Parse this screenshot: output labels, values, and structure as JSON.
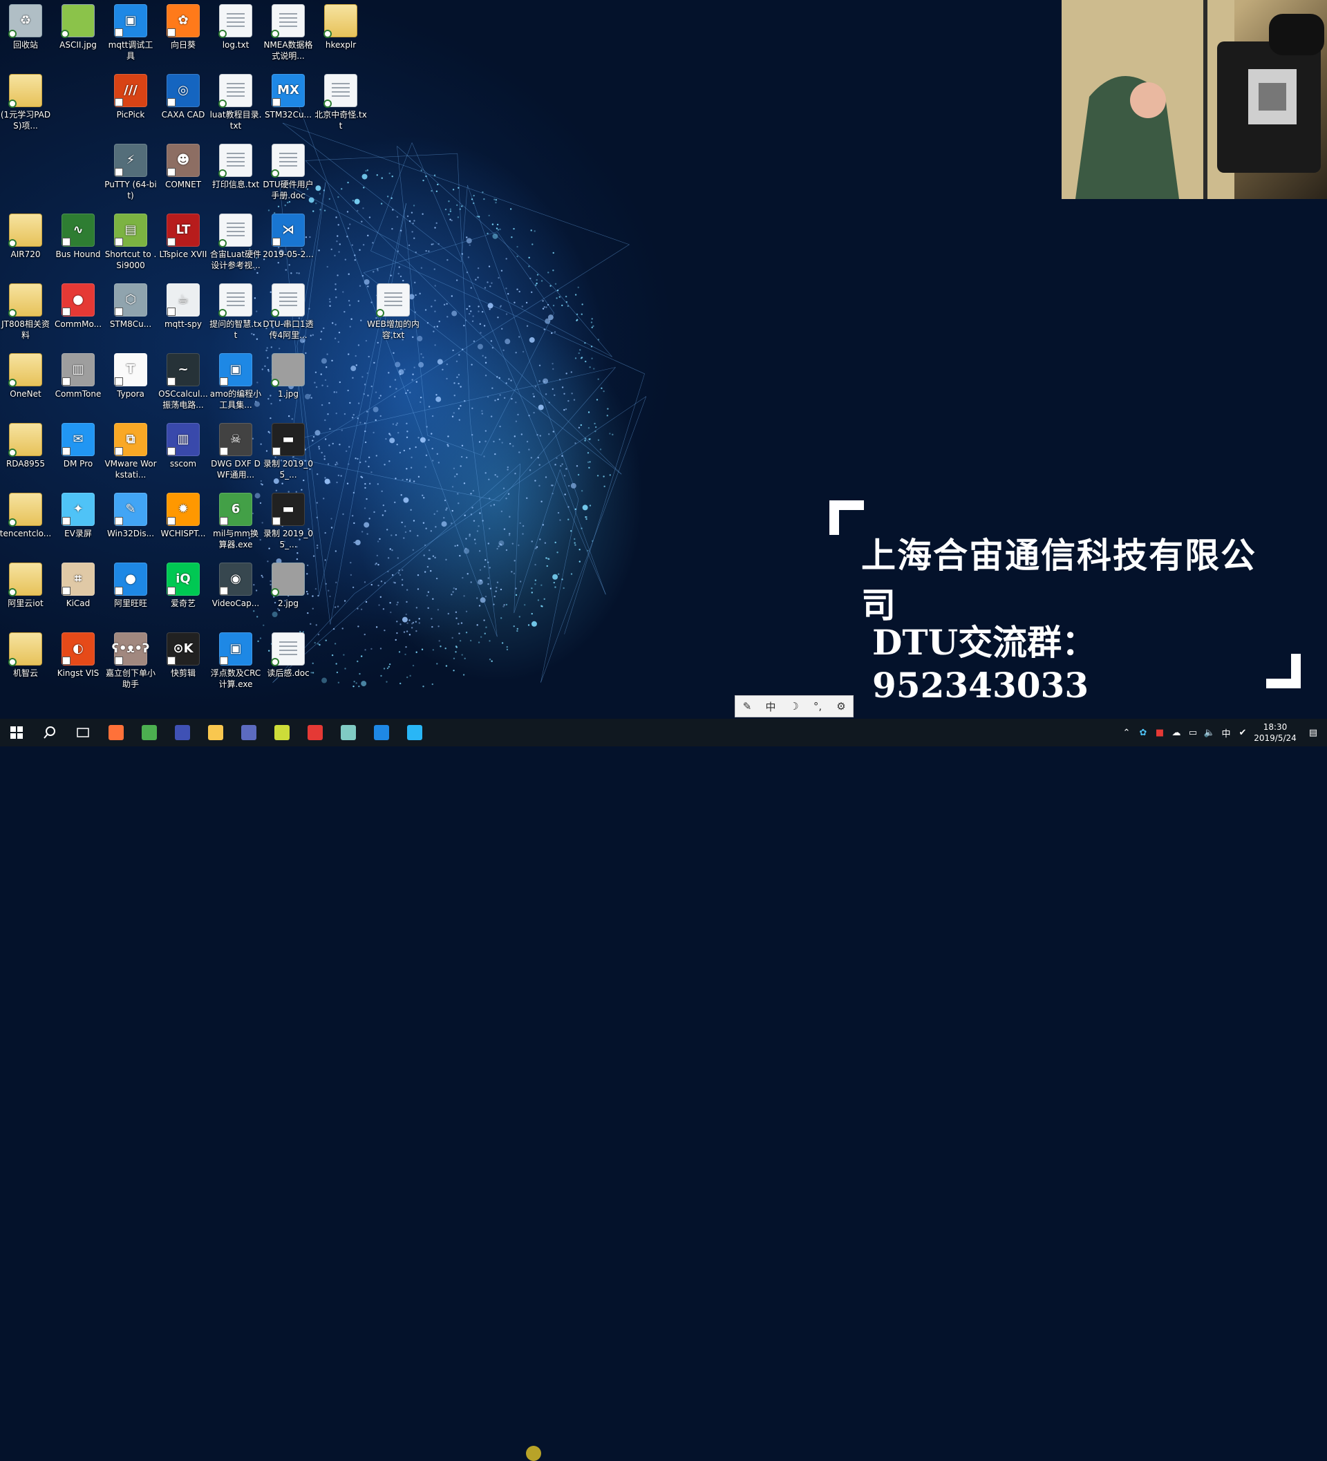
{
  "desktop_icons": [
    {
      "label": "回收站",
      "kind": "img",
      "color": "#b0bec5",
      "glyph": "♻"
    },
    {
      "label": "ASCII.jpg",
      "kind": "img",
      "color": "#8bc34a",
      "glyph": ""
    },
    {
      "label": "mqtt调试工具",
      "kind": "app",
      "color": "#1e88e5",
      "glyph": "▣"
    },
    {
      "label": "向日葵",
      "kind": "app",
      "color": "#ff7a1a",
      "glyph": "✿"
    },
    {
      "label": "log.txt",
      "kind": "doc",
      "color": "",
      "glyph": ""
    },
    {
      "label": "NMEA数据格式说明...",
      "kind": "doc",
      "color": "",
      "glyph": ""
    },
    {
      "label": "hkexplr",
      "kind": "folder",
      "color": "",
      "glyph": ""
    },
    {
      "label": "(1元学习PADS)项...",
      "kind": "folder",
      "color": "",
      "glyph": ""
    },
    {
      "label": "PicPick",
      "kind": "app",
      "color": "#d84315",
      "glyph": "///"
    },
    {
      "label": "CAXA CAD",
      "kind": "app",
      "color": "#1565c0",
      "glyph": "◎"
    },
    {
      "label": "luat教程目录.txt",
      "kind": "doc",
      "color": "",
      "glyph": ""
    },
    {
      "label": "STM32Cu...",
      "kind": "app",
      "color": "#1e88e5",
      "glyph": "MX"
    },
    {
      "label": "北京中奇怪.txt",
      "kind": "doc",
      "color": "",
      "glyph": ""
    },
    {
      "label": "PuTTY (64-bit)",
      "kind": "app",
      "color": "#546e7a",
      "glyph": "⚡"
    },
    {
      "label": "COMNET",
      "kind": "app",
      "color": "#8d6e63",
      "glyph": "☻"
    },
    {
      "label": "打印信息.txt",
      "kind": "doc",
      "color": "",
      "glyph": ""
    },
    {
      "label": "DTU硬件用户手册.doc",
      "kind": "doc",
      "color": "",
      "glyph": ""
    },
    {
      "label": "AIR720",
      "kind": "folder",
      "color": "",
      "glyph": ""
    },
    {
      "label": "Bus Hound",
      "kind": "app",
      "color": "#2e7d32",
      "glyph": "∿"
    },
    {
      "label": "Shortcut to .Si9000",
      "kind": "app",
      "color": "#7cb342",
      "glyph": "▤"
    },
    {
      "label": "LTspice XVII",
      "kind": "app",
      "color": "#b71c1c",
      "glyph": "LT"
    },
    {
      "label": "合宙Luat硬件设计参考视...",
      "kind": "doc",
      "color": "",
      "glyph": ""
    },
    {
      "label": "2019-05-2...",
      "kind": "app",
      "color": "#1976d2",
      "glyph": "⋊"
    },
    {
      "label": "JT808相关资料",
      "kind": "folder",
      "color": "",
      "glyph": ""
    },
    {
      "label": "CommMo...",
      "kind": "app",
      "color": "#e53935",
      "glyph": "●"
    },
    {
      "label": "STM8Cu...",
      "kind": "app",
      "color": "#90a4ae",
      "glyph": "⬡"
    },
    {
      "label": "mqtt-spy",
      "kind": "app",
      "color": "#eceff1",
      "glyph": "☕"
    },
    {
      "label": "提问的智慧.txt",
      "kind": "doc",
      "color": "",
      "glyph": ""
    },
    {
      "label": "DTU-串口1透传4阿里...",
      "kind": "doc",
      "color": "",
      "glyph": ""
    },
    {
      "label": "WEB增加的内容.txt",
      "kind": "doc",
      "color": "",
      "glyph": ""
    },
    {
      "label": "OneNet",
      "kind": "folder",
      "color": "",
      "glyph": ""
    },
    {
      "label": "CommTone",
      "kind": "app",
      "color": "#9e9e9e",
      "glyph": "▥"
    },
    {
      "label": "Typora",
      "kind": "app",
      "color": "#fafafa",
      "glyph": "T"
    },
    {
      "label": "OSCcalcul...振荡电路...",
      "kind": "app",
      "color": "#263238",
      "glyph": "~"
    },
    {
      "label": "amo的编程小工具集...",
      "kind": "app",
      "color": "#1e88e5",
      "glyph": "▣"
    },
    {
      "label": "1.jpg",
      "kind": "img",
      "color": "#9e9e9e",
      "glyph": ""
    },
    {
      "label": "RDA8955",
      "kind": "folder",
      "color": "",
      "glyph": ""
    },
    {
      "label": "DM Pro",
      "kind": "app",
      "color": "#2196f3",
      "glyph": "✉"
    },
    {
      "label": "VMware Workstati...",
      "kind": "app",
      "color": "#f9a825",
      "glyph": "⧉"
    },
    {
      "label": "sscom",
      "kind": "app",
      "color": "#3949ab",
      "glyph": "▥"
    },
    {
      "label": "DWG DXF DWF通用...",
      "kind": "app",
      "color": "#424242",
      "glyph": "☠"
    },
    {
      "label": "录制 2019_05_...",
      "kind": "app",
      "color": "#212121",
      "glyph": "▬"
    },
    {
      "label": "tencentclo...",
      "kind": "folder",
      "color": "",
      "glyph": ""
    },
    {
      "label": "EV录屏",
      "kind": "app",
      "color": "#4fc3f7",
      "glyph": "✦"
    },
    {
      "label": "Win32Dis...",
      "kind": "app",
      "color": "#42a5f5",
      "glyph": "✎"
    },
    {
      "label": "WCHISPT...",
      "kind": "app",
      "color": "#ff9800",
      "glyph": "✹"
    },
    {
      "label": "mil与mm换算器.exe",
      "kind": "app",
      "color": "#43a047",
      "glyph": "6"
    },
    {
      "label": "录制 2019_05_...",
      "kind": "app",
      "color": "#212121",
      "glyph": "▬"
    },
    {
      "label": "阿里云iot",
      "kind": "folder",
      "color": "",
      "glyph": ""
    },
    {
      "label": "KiCad",
      "kind": "app",
      "color": "#e0c9a6",
      "glyph": "⌗"
    },
    {
      "label": "阿里旺旺",
      "kind": "app",
      "color": "#1e88e5",
      "glyph": "●"
    },
    {
      "label": "爱奇艺",
      "kind": "app",
      "color": "#00c853",
      "glyph": "iQ"
    },
    {
      "label": "VideoCap...",
      "kind": "app",
      "color": "#37474f",
      "glyph": "◉"
    },
    {
      "label": "2.jpg",
      "kind": "img",
      "color": "#9e9e9e",
      "glyph": ""
    },
    {
      "label": "机智云",
      "kind": "folder",
      "color": "",
      "glyph": ""
    },
    {
      "label": "Kingst VIS",
      "kind": "app",
      "color": "#e64a19",
      "glyph": "◐"
    },
    {
      "label": "嘉立创下单小助手",
      "kind": "app",
      "color": "#a1887f",
      "glyph": "ʕ•ᴥ•ʔ"
    },
    {
      "label": "快剪辑",
      "kind": "app",
      "color": "#212121",
      "glyph": "⊙K"
    },
    {
      "label": "浮点数及CRC计算.exe",
      "kind": "app",
      "color": "#1e88e5",
      "glyph": "▣"
    },
    {
      "label": "读后感.doc",
      "kind": "doc",
      "color": "",
      "glyph": ""
    }
  ],
  "banner": {
    "company": "上海合宙通信科技有限公司",
    "dtu_group": "DTU交流群：952343033"
  },
  "ime_bar": [
    "✎",
    "中",
    "☽",
    "°,",
    "⚙"
  ],
  "taskbar": {
    "apps": [
      {
        "name": "firefox",
        "color": "#ff7139"
      },
      {
        "name": "chrome",
        "color": "#4caf50"
      },
      {
        "name": "app-blue",
        "color": "#3f51b5"
      },
      {
        "name": "file-explorer",
        "color": "#f9c74f"
      },
      {
        "name": "sscom",
        "color": "#5c6bc0"
      },
      {
        "name": "terminal",
        "color": "#cddc39"
      },
      {
        "name": "pdf-reader",
        "color": "#e53935"
      },
      {
        "name": "notepad",
        "color": "#80cbc4"
      },
      {
        "name": "editor",
        "color": "#1e88e5"
      },
      {
        "name": "vscode",
        "color": "#29b6f6"
      }
    ],
    "clock_time": "18:30",
    "clock_date": "2019/5/24",
    "ime_indicator": "中"
  }
}
